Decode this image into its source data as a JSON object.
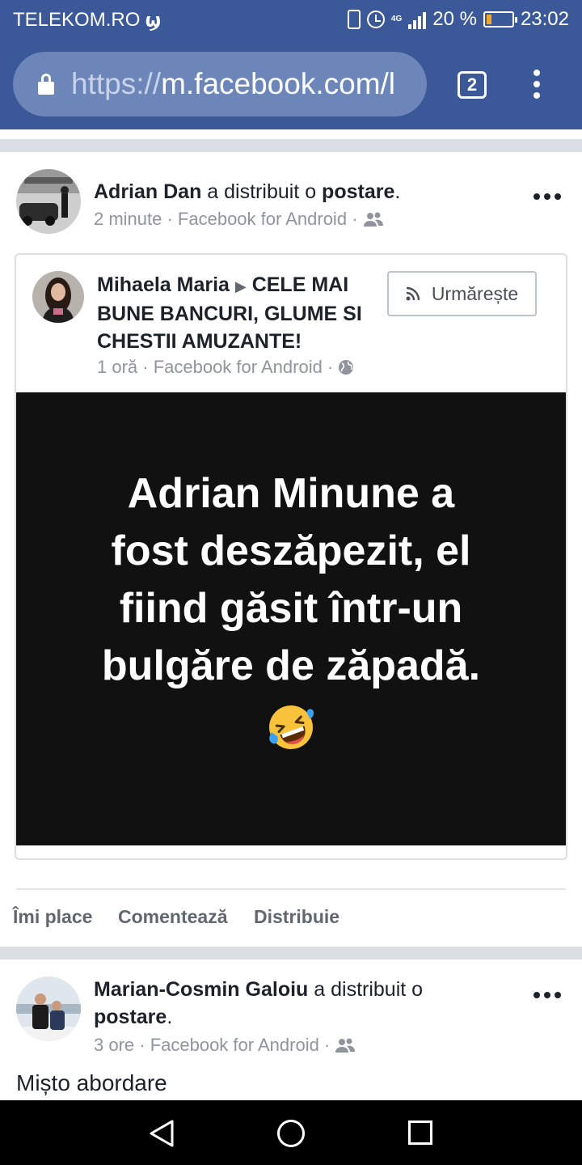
{
  "status_bar": {
    "carrier": "TELEKOM.RO",
    "battery": "20 %",
    "time": "23:02",
    "network": "4G"
  },
  "browser": {
    "url_protocol": "https://",
    "url_host": "m.facebook.com/l",
    "tab_count": "2"
  },
  "post1": {
    "author": "Adrian Dan",
    "action_text": " a distribuit o ",
    "object": "postare",
    "punct": ".",
    "meta": "2 minute · Facebook for Android ·",
    "privacy_icon": "friends-icon",
    "shared": {
      "author": "Mihaela Maria",
      "group_line1": "CELE MAI",
      "group_line2": "BUNE BANCURI, GLUME SI",
      "group_line3": "CHESTII AMUZANTE!",
      "meta": "1 oră · Facebook for Android ·",
      "privacy_icon": "globe-icon",
      "follow_label": "Urmărește",
      "image_lines": [
        "Adrian Minune a",
        "fost deszăpezit, el",
        "fiind găsit într-un",
        "bulgăre de zăpadă."
      ],
      "emoji": "rolling-on-floor-laughing"
    },
    "actions": {
      "like": "Îmi place",
      "comment": "Comentează",
      "share": "Distribuie"
    }
  },
  "post2": {
    "author": "Marian-Cosmin Galoiu",
    "action_text": " a distribuit o",
    "object": "postare",
    "punct": ".",
    "meta": "3 ore · Facebook for Android ·",
    "privacy_icon": "friends-icon",
    "text": "Mișto abordare"
  },
  "colors": {
    "facebook_blue": "#3b5998",
    "url_bar": "#6d86b9",
    "separator": "#dadde1",
    "meta_gray": "#90949c"
  }
}
